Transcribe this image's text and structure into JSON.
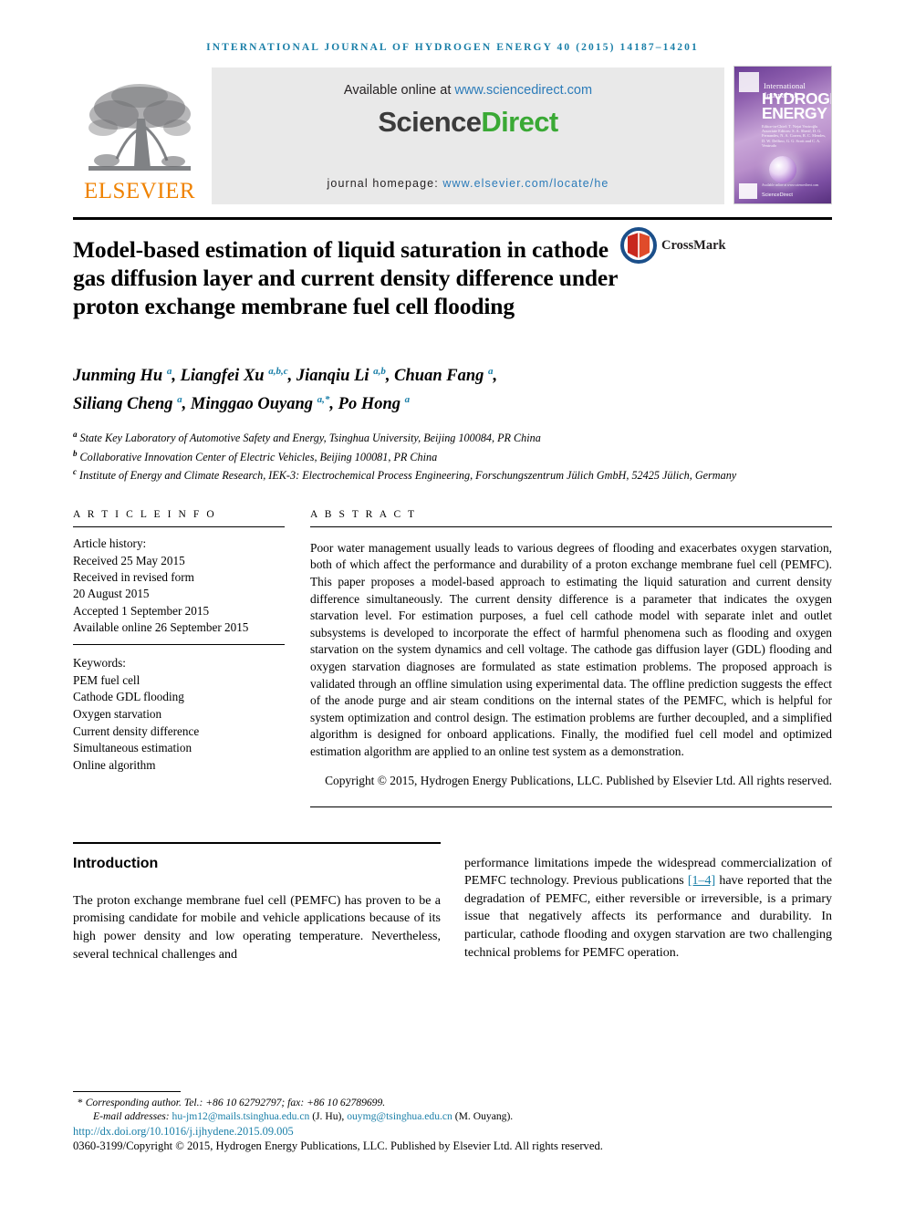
{
  "running_head": "INTERNATIONAL JOURNAL OF HYDROGEN ENERGY 40 (2015) 14187–14201",
  "masthead": {
    "publisher_name": "ELSEVIER",
    "available_prefix": "Available online at",
    "available_link": "www.sciencedirect.com",
    "sciencedirect_part1": "Science",
    "sciencedirect_part2": "Direct",
    "homepage_label": "journal homepage:",
    "homepage_link": "www.elsevier.com/locate/he",
    "cover": {
      "line_small": "International Journal of",
      "line_big_1": "HYDROGEN",
      "line_big_2": "ENERGY",
      "editors": "Editor-in-Chief: T. Nejat Veziroğlu\nAssociate Editors: S. A. Sherif, D. G. Fernandes, N. A. Correa, R. C. Mendes, D. W. Delfino, G. G. Scott and C. A. Ventrudo",
      "sciencedirect": "ScienceDirect",
      "available_top": "Available online at www.sciencedirect.com"
    }
  },
  "crossmark": {
    "label": "CrossMark"
  },
  "title": "Model-based estimation of liquid saturation in cathode gas diffusion layer and current density difference under proton exchange membrane fuel cell flooding",
  "authors": [
    {
      "name": "Junming Hu",
      "sup": "a",
      "sep": ", "
    },
    {
      "name": "Liangfei Xu",
      "sup": "a,b,c",
      "sep": ", "
    },
    {
      "name": "Jianqiu Li",
      "sup": "a,b",
      "sep": ", "
    },
    {
      "name": "Chuan Fang",
      "sup": "a",
      "sep": ", "
    },
    {
      "name": "Siliang Cheng",
      "sup": "a",
      "sep": ", "
    },
    {
      "name": "Minggao Ouyang",
      "sup": "a,*",
      "sep": ", "
    },
    {
      "name": "Po Hong",
      "sup": "a",
      "sep": ""
    }
  ],
  "affiliations": [
    {
      "marker": "a",
      "text": "State Key Laboratory of Automotive Safety and Energy, Tsinghua University, Beijing 100084, PR China"
    },
    {
      "marker": "b",
      "text": "Collaborative Innovation Center of Electric Vehicles, Beijing 100081, PR China"
    },
    {
      "marker": "c",
      "text": "Institute of Energy and Climate Research, IEK-3: Electrochemical Process Engineering, Forschungszentrum Jülich GmbH, 52425 Jülich, Germany"
    }
  ],
  "article_info": {
    "heading": "A R T I C L E   I N F O",
    "history_label": "Article history:",
    "history": [
      "Received 25 May 2015",
      "Received in revised form",
      "20 August 2015",
      "Accepted 1 September 2015",
      "Available online 26 September 2015"
    ],
    "keywords_label": "Keywords:",
    "keywords": [
      "PEM fuel cell",
      "Cathode GDL flooding",
      "Oxygen starvation",
      "Current density difference",
      "Simultaneous estimation",
      "Online algorithm"
    ]
  },
  "abstract": {
    "heading": "A B S T R A C T",
    "text": "Poor water management usually leads to various degrees of flooding and exacerbates oxygen starvation, both of which affect the performance and durability of a proton exchange membrane fuel cell (PEMFC). This paper proposes a model-based approach to estimating the liquid saturation and current density difference simultaneously. The current density difference is a parameter that indicates the oxygen starvation level. For estimation purposes, a fuel cell cathode model with separate inlet and outlet subsystems is developed to incorporate the effect of harmful phenomena such as flooding and oxygen starvation on the system dynamics and cell voltage. The cathode gas diffusion layer (GDL) flooding and oxygen starvation diagnoses are formulated as state estimation problems. The proposed approach is validated through an offline simulation using experimental data. The offline prediction suggests the effect of the anode purge and air steam conditions on the internal states of the PEMFC, which is helpful for system optimization and control design. The estimation problems are further decoupled, and a simplified algorithm is designed for onboard applications. Finally, the modified fuel cell model and optimized estimation algorithm are applied to an online test system as a demonstration.",
    "copyright": "Copyright © 2015, Hydrogen Energy Publications, LLC. Published by Elsevier Ltd. All rights reserved."
  },
  "introduction": {
    "heading": "Introduction",
    "left_paragraph": "The proton exchange membrane fuel cell (PEMFC) has proven to be a promising candidate for mobile and vehicle applications because of its high power density and low operating temperature. Nevertheless, several technical challenges and",
    "right_part1": "performance limitations impede the widespread commercialization of PEMFC technology. Previous publications ",
    "right_citation": "[1–4]",
    "right_part2": " have reported that the degradation of PEMFC, either reversible or irreversible, is a primary issue that negatively affects its performance and durability. In particular, cathode flooding and oxygen starvation are two challenging technical problems for PEMFC operation."
  },
  "footnotes": {
    "corresponding_star": "*",
    "corresponding": "Corresponding author. Tel.: +86 10 62792797; fax: +86 10 62789699.",
    "email_label": "E-mail addresses:",
    "email1": "hu-jm12@mails.tsinghua.edu.cn",
    "email1_owner": "(J. Hu),",
    "email2": "ouymg@tsinghua.edu.cn",
    "email2_owner": "(M. Ouyang).",
    "doi": "http://dx.doi.org/10.1016/j.ijhydene.2015.09.005",
    "copyright": "0360-3199/Copyright © 2015, Hydrogen Energy Publications, LLC. Published by Elsevier Ltd. All rights reserved."
  },
  "colors": {
    "link_blue": "#1a7fa8",
    "sciencedirect_green": "#3aa935",
    "elsevier_orange": "#ef8200"
  }
}
